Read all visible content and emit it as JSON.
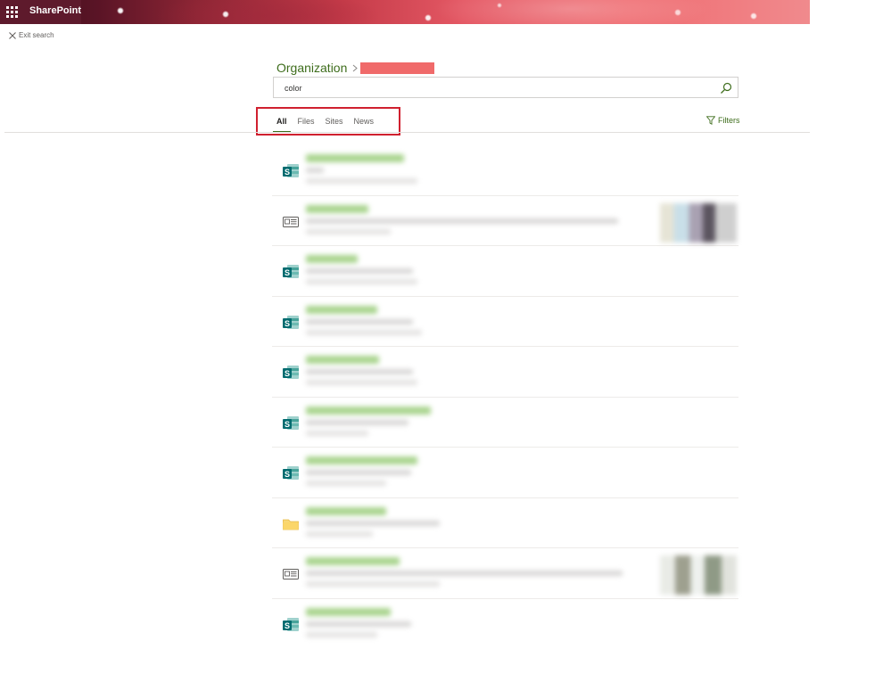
{
  "suitebar": {
    "app_name": "SharePoint"
  },
  "exit_search": {
    "label": "Exit search"
  },
  "breadcrumb": {
    "root": "Organization"
  },
  "search": {
    "value": "color"
  },
  "tabs": [
    {
      "label": "All",
      "active": true
    },
    {
      "label": "Files",
      "active": false
    },
    {
      "label": "Sites",
      "active": false
    },
    {
      "label": "News",
      "active": false
    }
  ],
  "filters": {
    "label": "Filters"
  },
  "colors": {
    "accent": "#3e6d1c",
    "highlight_box": "#d0202f",
    "redaction": "#f06a6a",
    "suitebar_dark": "#5e1a2c"
  },
  "results": [
    {
      "icon": "sharepoint-site-icon",
      "thumbnail": false
    },
    {
      "icon": "news-article-icon",
      "thumbnail": true
    },
    {
      "icon": "sharepoint-site-icon",
      "thumbnail": false
    },
    {
      "icon": "sharepoint-site-icon",
      "thumbnail": false
    },
    {
      "icon": "sharepoint-site-icon",
      "thumbnail": false
    },
    {
      "icon": "sharepoint-site-icon",
      "thumbnail": false
    },
    {
      "icon": "sharepoint-site-icon",
      "thumbnail": false
    },
    {
      "icon": "folder-icon",
      "thumbnail": false
    },
    {
      "icon": "news-article-icon",
      "thumbnail": true
    },
    {
      "icon": "sharepoint-site-icon",
      "thumbnail": false
    }
  ]
}
